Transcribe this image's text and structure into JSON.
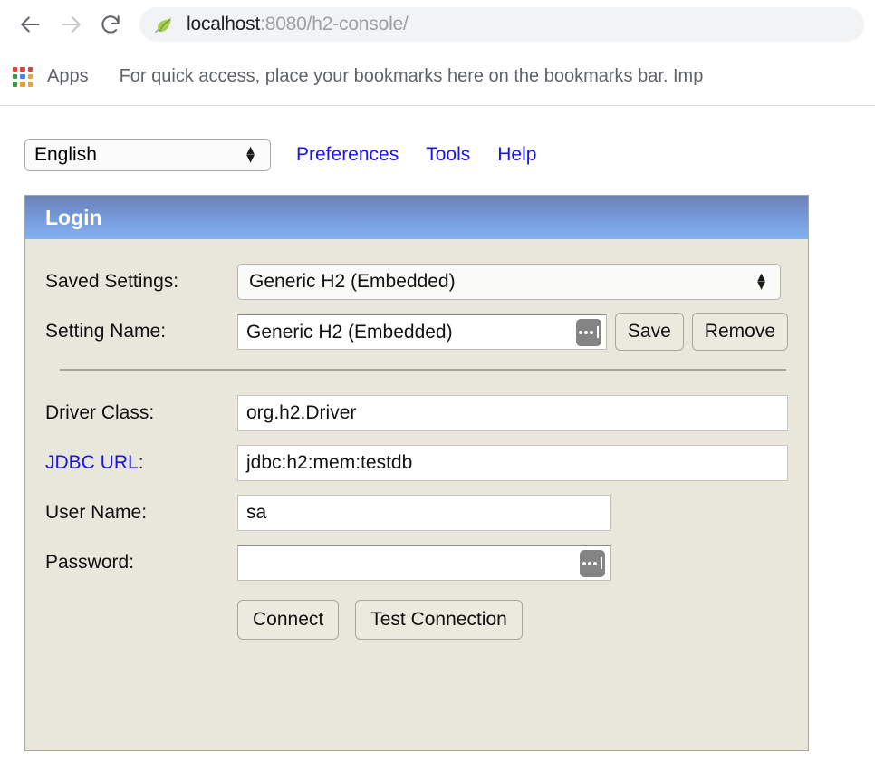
{
  "browser": {
    "back_icon": "arrow-left-icon",
    "forward_icon": "arrow-right-icon",
    "reload_icon": "reload-icon",
    "favicon": "spring-leaf-favicon",
    "url_host": "localhost",
    "url_path": ":8080/h2-console/",
    "apps_label": "Apps",
    "apps_icon": "apps-grid-icon",
    "bookmarks_hint": "For quick access, place your bookmarks here on the bookmarks bar. Imp"
  },
  "topbar": {
    "language": "English",
    "language_options": [
      "English"
    ],
    "links": [
      {
        "label": "Preferences"
      },
      {
        "label": "Tools"
      },
      {
        "label": "Help"
      }
    ]
  },
  "panel": {
    "title": "Login",
    "saved_settings": {
      "label": "Saved Settings:",
      "value": "Generic H2 (Embedded)",
      "options": [
        "Generic H2 (Embedded)"
      ]
    },
    "setting_name": {
      "label": "Setting Name:",
      "value": "Generic H2 (Embedded)",
      "save_label": "Save",
      "remove_label": "Remove"
    },
    "driver_class": {
      "label": "Driver Class:",
      "value": "org.h2.Driver"
    },
    "jdbc_url": {
      "label": "JDBC URL",
      "label_colon": ":",
      "value": "jdbc:h2:mem:testdb"
    },
    "user_name": {
      "label": "User Name:",
      "value": "sa"
    },
    "password": {
      "label": "Password:",
      "value": ""
    },
    "connect_label": "Connect",
    "test_connection_label": "Test Connection"
  },
  "colors": {
    "panel_bg": "#e9e7db",
    "header_blue_top": "#6c82b5",
    "header_blue_bottom": "#82b2f2",
    "link_blue": "#1a14e8",
    "button_bg": "#eceade"
  }
}
